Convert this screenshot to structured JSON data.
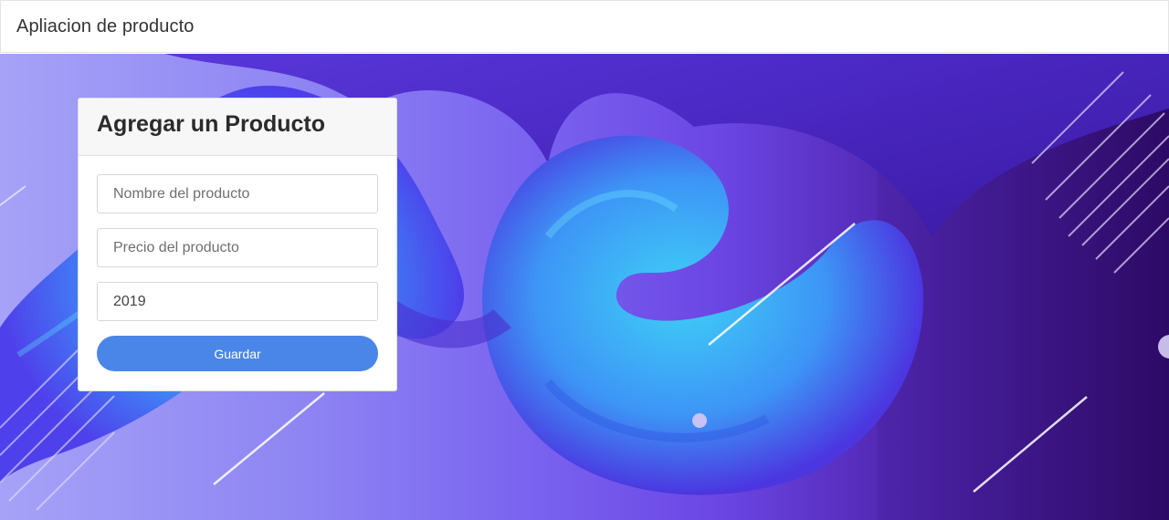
{
  "navbar": {
    "brand": "Apliacion de producto"
  },
  "form": {
    "title": "Agregar un Producto",
    "name_placeholder": "Nombre del producto",
    "price_placeholder": "Precio del producto",
    "year_value": "2019",
    "save_label": "Guardar"
  },
  "colors": {
    "button": "#4a86e8",
    "header_bg": "#f7f7f7",
    "hero_start": "#a6a2f7",
    "hero_end": "#2f0a68"
  }
}
